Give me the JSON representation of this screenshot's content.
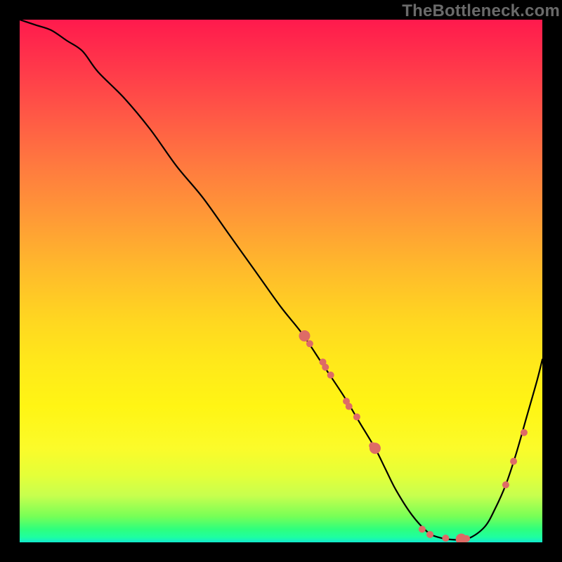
{
  "watermark": "TheBottleneck.com",
  "chart_data": {
    "type": "line",
    "title": "",
    "xlabel": "",
    "ylabel": "",
    "xlim": [
      0,
      100
    ],
    "ylim": [
      0,
      100
    ],
    "series": [
      {
        "name": "curve",
        "x": [
          0,
          3,
          6,
          9,
          12,
          15,
          20,
          25,
          30,
          35,
          40,
          45,
          50,
          54,
          58,
          62,
          65,
          68,
          70,
          72,
          75,
          78,
          80,
          83,
          86,
          89,
          91,
          93,
          95,
          97,
          99,
          100
        ],
        "values": [
          100,
          99,
          98,
          96,
          94,
          90,
          85,
          79,
          72,
          66,
          59,
          52,
          45,
          40,
          34,
          28,
          23,
          18,
          14,
          10,
          5.3,
          2.0,
          1.0,
          0.5,
          0.8,
          3.0,
          6.5,
          11,
          17,
          24,
          31,
          35
        ]
      }
    ],
    "points": {
      "name": "dots",
      "x": [
        54.5,
        55.5,
        58.0,
        58.5,
        59.5,
        62.5,
        63.0,
        64.5,
        67.5,
        68.0,
        77.0,
        78.5,
        81.5,
        84.5,
        85.5,
        93.0,
        94.5,
        96.5
      ],
      "values": [
        39.5,
        38.0,
        34.5,
        33.5,
        32.0,
        27.0,
        26.0,
        24.0,
        18.5,
        18.0,
        2.5,
        1.5,
        0.8,
        0.6,
        0.7,
        11.0,
        15.5,
        21.0
      ],
      "r_small": 5,
      "r_large_idx": [
        0,
        9,
        13
      ],
      "r_large": 8
    }
  }
}
